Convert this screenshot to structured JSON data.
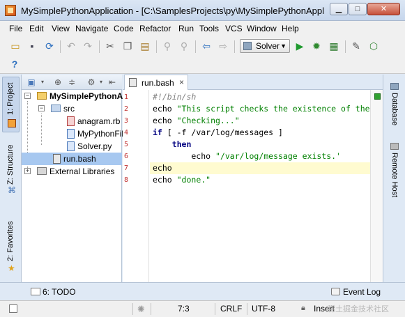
{
  "window": {
    "title": "MySimplePythonApplication - [C:\\SamplesProjects\\py\\MySimplePythonApplicati...",
    "minimize_glyph": "▁",
    "maximize_glyph": "□",
    "close_glyph": "✕"
  },
  "menu": [
    "File",
    "Edit",
    "View",
    "Navigate",
    "Code",
    "Refactor",
    "Run",
    "Tools",
    "VCS",
    "Window",
    "Help"
  ],
  "toolbar": {
    "run_config": "Solver",
    "icons": [
      "open-folder-icon",
      "save-icon",
      "sync-icon",
      "undo-icon",
      "redo-icon",
      "cut-icon",
      "copy-icon",
      "paste-icon",
      "find-icon",
      "replace-icon",
      "back-icon",
      "forward-icon",
      "run-icon",
      "debug-icon",
      "coverage-icon",
      "settings-icon",
      "sdk-icon",
      "help-icon"
    ]
  },
  "left_tabs": {
    "project": "1: Project",
    "structure": "Z: Structure",
    "favorites": "2: Favorites"
  },
  "project_tree": {
    "root": "MySimplePythonA",
    "src": "src",
    "files": [
      "anagram.rb",
      "MyPythonFile",
      "Solver.py"
    ],
    "run_bash": "run.bash",
    "external": "External Libraries"
  },
  "editor": {
    "tab_label": "run.bash",
    "tab_close": "×",
    "line_numbers": [
      "1",
      "2",
      "3",
      "4",
      "5",
      "6",
      "7",
      "8"
    ],
    "lines": [
      [
        {
          "c": "comment",
          "t": "#!/bin/sh"
        }
      ],
      [
        {
          "c": "plain",
          "t": "echo "
        },
        {
          "c": "str",
          "t": "\"This script checks the existence of the"
        }
      ],
      [
        {
          "c": "plain",
          "t": "echo "
        },
        {
          "c": "str",
          "t": "\"Checking...\""
        }
      ],
      [
        {
          "c": "kw",
          "t": "if"
        },
        {
          "c": "plain",
          "t": " [ -f /var/log/messages ]"
        }
      ],
      [
        {
          "c": "plain",
          "t": "    "
        },
        {
          "c": "kw",
          "t": "then"
        }
      ],
      [
        {
          "c": "plain",
          "t": "        echo "
        },
        {
          "c": "str",
          "t": "\"/var/log/message exists.'"
        }
      ],
      [
        {
          "c": "plain",
          "t": "echo"
        }
      ],
      [
        {
          "c": "plain",
          "t": "echo "
        },
        {
          "c": "str",
          "t": "\"done.\""
        }
      ]
    ],
    "current_line": 7
  },
  "right_tabs": {
    "database": "Database",
    "remote_host": "Remote Host"
  },
  "bottom_bar": {
    "todo": "6: TODO",
    "event_log": "Event Log"
  },
  "status_bar": {
    "position": "7:3",
    "line_separator": "CRLF",
    "encoding": "UTF-8",
    "insert_mode": "Insert",
    "watermark": "稀土掘金技术社区"
  },
  "colors": {
    "line_number": "#c03030",
    "keyword": "#000080",
    "string": "#008000",
    "comment": "#808080",
    "current_line_bg": "#fffbd0",
    "selection": "#a7c8f0"
  }
}
